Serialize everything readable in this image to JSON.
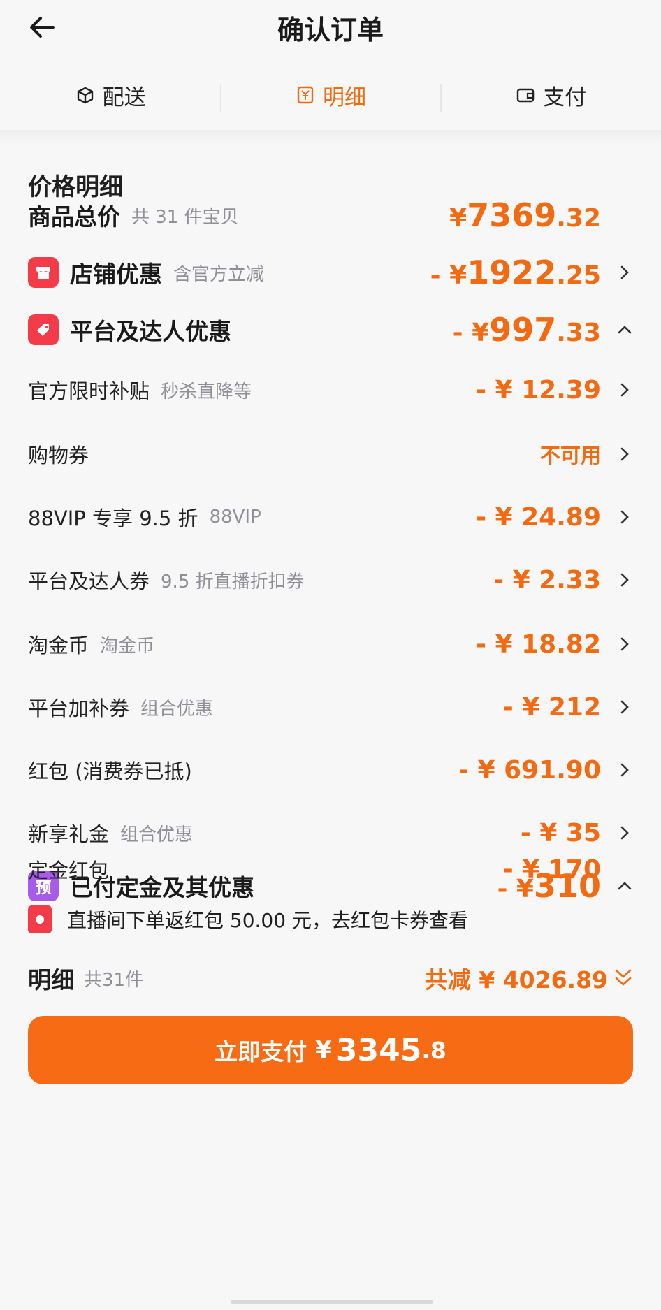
{
  "header": {
    "title": "确认订单"
  },
  "tabs": [
    {
      "label": "配送",
      "icon": "box-icon"
    },
    {
      "label": "明细",
      "icon": "yuan-icon",
      "active": true
    },
    {
      "label": "支付",
      "icon": "wallet-icon"
    }
  ],
  "section_title": "价格明细",
  "goods_total": {
    "label": "商品总价",
    "sub": "共 31 件宝贝",
    "currency": "¥",
    "integer": "7369",
    "decimal": ".32"
  },
  "shop_discount": {
    "label": "店铺优惠",
    "sub": "含官方立减",
    "prefix": "- ¥",
    "integer": "1922",
    "decimal": ".25",
    "icon": "shop-icon"
  },
  "platform_discount": {
    "label": "平台及达人优惠",
    "prefix": "- ¥",
    "integer": "997",
    "decimal": ".33",
    "icon": "tag-icon"
  },
  "platform_items": [
    {
      "label": "官方限时补贴",
      "sub": "秒杀直降等",
      "amount": "- ¥ 12.39"
    },
    {
      "label": "购物券",
      "sub": "",
      "amount": "不可用",
      "muted": true
    },
    {
      "label": "88VIP 专享 9.5 折",
      "sub": "88VIP",
      "amount": "- ¥ 24.89"
    },
    {
      "label": "平台及达人券",
      "sub": "9.5 折直播折扣券",
      "amount": "- ¥ 2.33"
    },
    {
      "label": "淘金币",
      "sub": "淘金币",
      "amount": "- ¥ 18.82"
    },
    {
      "label": "平台加补券",
      "sub": "组合优惠",
      "amount": "- ¥ 212"
    },
    {
      "label": "红包 (消费券已抵)",
      "sub": "",
      "amount": "- ¥ 691.90"
    },
    {
      "label": "新享礼金",
      "sub": "组合优惠",
      "amount": "- ¥ 35"
    }
  ],
  "deposit": {
    "label": "已付定金及其优惠",
    "badge": "预",
    "prefix": "- ¥",
    "integer": "310"
  },
  "deposit_items": [
    {
      "label": "定金红包",
      "amount": "- ¥ 170"
    }
  ],
  "notice": "直播间下单返红包 50.00 元，去红包卡券查看",
  "summary": {
    "label": "明细",
    "count": "共31件",
    "total": "共减 ¥ 4026.89"
  },
  "pay_button": {
    "label": "立即支付",
    "currency": "¥",
    "integer": "3345",
    "decimal": ".8"
  },
  "colors": {
    "accent": "#f26b12",
    "button": "#f86b15",
    "red_badge": "#f43b4a",
    "purple_badge": "#a65be9"
  }
}
